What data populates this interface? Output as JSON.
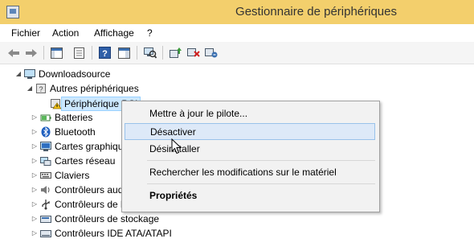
{
  "window": {
    "title": "Gestionnaire de périphériques"
  },
  "menu": [
    "Fichier",
    "Action",
    "Affichage",
    "?"
  ],
  "toolbar": {
    "buttons": [
      "back-icon",
      "forward-icon",
      "show-hide-console-tree-icon",
      "properties-icon",
      "help-icon",
      "action-pane-icon",
      "scan-hardware-icon",
      "update-driver-icon",
      "disable-device-icon",
      "uninstall-device-icon"
    ]
  },
  "tree": {
    "root": "Downloadsource",
    "other_devices": "Autres périphériques",
    "selected_device": "Périphérique PCI",
    "categories": [
      "Batteries",
      "Bluetooth",
      "Cartes graphiques",
      "Cartes réseau",
      "Claviers",
      "Contrôleurs audio, vidéo et jeu",
      "Contrôleurs de bus USB",
      "Contrôleurs de stockage",
      "Contrôleurs IDE ATA/ATAPI"
    ]
  },
  "context_menu": {
    "items": [
      "Mettre à jour le pilote...",
      "Désactiver",
      "Désinstaller",
      "Rechercher les modifications sur le matériel",
      "Propriétés"
    ],
    "highlighted_index": 1
  },
  "colors": {
    "titlebar": "#f3cf6c",
    "selection": "#cce8ff",
    "menu_highlight": "#dde9f8"
  }
}
